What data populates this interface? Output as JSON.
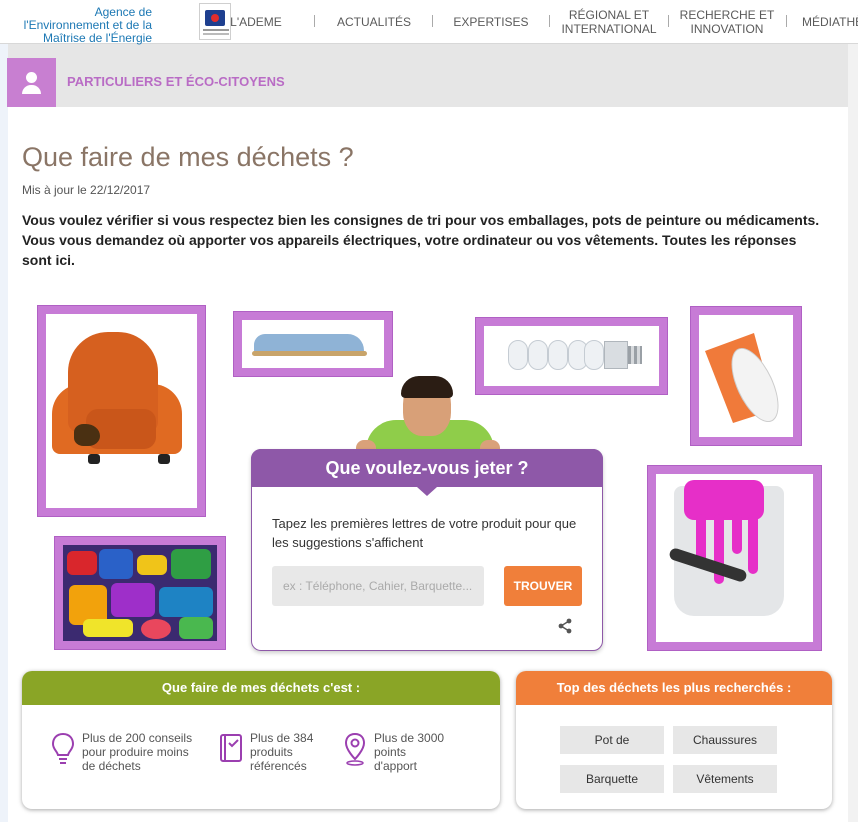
{
  "header": {
    "agency_line1": "Agence de",
    "agency_line2": "l'Environnement et de la",
    "agency_line3": "Maîtrise de l'Énergie",
    "nav": [
      {
        "label": "L'ADEME"
      },
      {
        "label": "ACTUALITÉS"
      },
      {
        "label": "EXPERTISES"
      },
      {
        "label": "RÉGIONAL ET INTERNATIONAL"
      },
      {
        "label": "RECHERCHE ET INNOVATION"
      },
      {
        "label": "MÉDIATHÈ"
      }
    ]
  },
  "section": {
    "title": "PARTICULIERS ET ÉCO-CITOYENS",
    "icon": "person-icon"
  },
  "article": {
    "title": "Que faire de mes déchets ?",
    "updated": "Mis à jour le 22/12/2017",
    "intro": "Vous voulez vérifier si vous respectez bien les consignes de tri pour vos emballages, pots de peinture ou médicaments. Vous vous demandez où apporter vos appareils électriques, votre ordinateur ou vos vêtements. Toutes les réponses sont ici."
  },
  "search": {
    "heading": "Que voulez-vous jeter ?",
    "instructions": "Tapez les premières lettres de votre produit pour que les suggestions s'affichent",
    "placeholder": "ex : Téléphone, Cahier, Barquette...",
    "button": "TROUVER"
  },
  "facts": {
    "heading": "Que faire de mes déchets c'est :",
    "accent": "#8aa526",
    "items": [
      {
        "icon": "lightbulb-icon",
        "text": "Plus de 200 conseils pour produire moins de déchets"
      },
      {
        "icon": "book-icon",
        "text": "Plus de 384 produits référencés"
      },
      {
        "icon": "map-pin-icon",
        "text": "Plus de 3000 points d'apport"
      }
    ]
  },
  "top": {
    "heading": "Top des déchets les plus recherchés :",
    "accent": "#f07f3a",
    "tags": [
      "Pot de",
      "Chaussures",
      "Barquette",
      "Vêtements"
    ]
  },
  "colors": {
    "purple": "#c77bd6",
    "widget": "#8e58a8"
  }
}
